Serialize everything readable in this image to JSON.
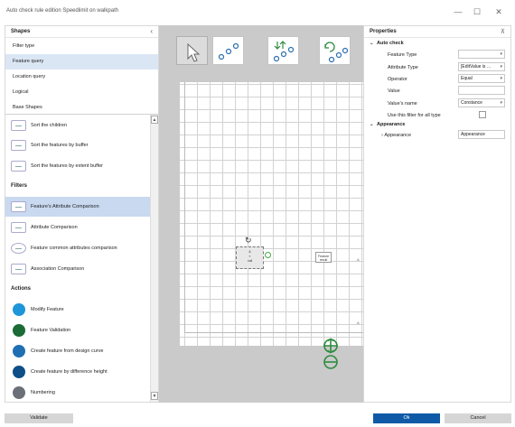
{
  "window": {
    "title": "Auto check rule edition Speedlimit on walkpath",
    "minimize_glyph": "—",
    "maximize_glyph": "☐",
    "close_glyph": "✕"
  },
  "shapes_panel": {
    "title": "Shapes",
    "collapse_glyph": "‹",
    "categories": [
      {
        "label": "Filter type"
      },
      {
        "label": "Feature query",
        "selected": true
      },
      {
        "label": "Location query"
      },
      {
        "label": "Logical"
      },
      {
        "label": "Base Shapes"
      }
    ],
    "items_top": [
      {
        "label": "Sort the children",
        "icon": "table-icon"
      },
      {
        "label": "Sort the features by buffer",
        "icon": "table-icon"
      },
      {
        "label": "Sort the features by extent buffer",
        "icon": "table-icon"
      }
    ],
    "filters_heading": "Filters",
    "filters": [
      {
        "label": "Feature's Attribute Comparison",
        "icon": "table-icon",
        "selected": true
      },
      {
        "label": "Attribute Comparison",
        "icon": "table-icon"
      },
      {
        "label": "Feature common attributes comparison",
        "icon": "table-icon"
      },
      {
        "label": "Association Comparison",
        "icon": "table-icon"
      }
    ],
    "actions_heading": "Actions",
    "actions": [
      {
        "label": "Modify Feature",
        "color": "#1e96d9"
      },
      {
        "label": "Feature Validation",
        "color": "#1a6b35"
      },
      {
        "label": "Create feature from design curve",
        "color": "#1f6fb3"
      },
      {
        "label": "Create feature by difference height",
        "color": "#0d4f86"
      },
      {
        "label": "Numbering",
        "color": "#6b6f78"
      }
    ]
  },
  "canvas": {
    "tools": [
      {
        "name": "pointer-tool",
        "selected": true
      },
      {
        "name": "connector-tool"
      },
      {
        "name": "sort-connector-tool"
      },
      {
        "name": "loop-connector-tool"
      }
    ],
    "node_main_lines": [
      "&",
      "«",
      "null"
    ],
    "node_result_lines": [
      "Feature",
      "result"
    ],
    "tick_a": "A",
    "tick_b": "A",
    "accent_green": "#2e8b3f"
  },
  "properties": {
    "title": "Properties",
    "pin_glyph": "⊼",
    "auto_check_heading": "Auto check",
    "rows": [
      {
        "label": "Feature Type",
        "value": "",
        "dropdown": true
      },
      {
        "label": "Attribute Type",
        "value": "[EditValue is ...",
        "dropdown": true
      },
      {
        "label": "Operator",
        "value": "Equal",
        "dropdown": true
      },
      {
        "label": "Value",
        "value": "",
        "dropdown": false
      },
      {
        "label": "Value's name",
        "value": "Constance",
        "dropdown": true
      },
      {
        "label": "Use this filter for all type",
        "value": "",
        "checkbox": true
      }
    ],
    "appearance_heading": "Appearance",
    "appearance_row": {
      "label": "Appearance",
      "value": "Appearance"
    }
  },
  "footer": {
    "validate_label": "Validate",
    "ok_label": "Ok",
    "cancel_label": "Cancel",
    "ok_color": "#0e5aa7"
  }
}
